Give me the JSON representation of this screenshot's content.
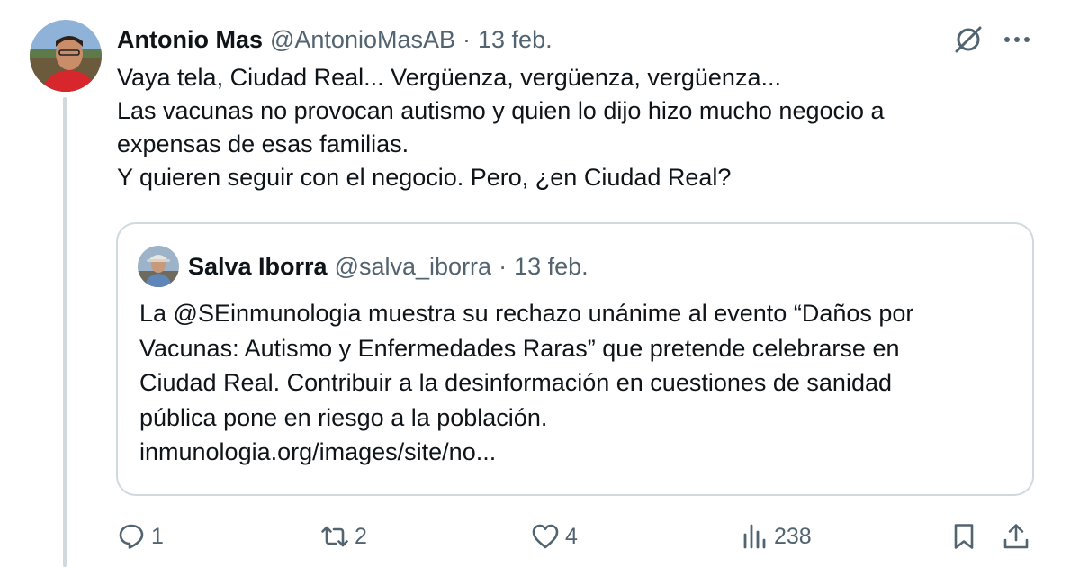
{
  "tweet": {
    "author": {
      "name": "Antonio Mas",
      "handle": "@AntonioMasAB",
      "separator": "·",
      "date": "13 feb."
    },
    "lines": [
      "Vaya tela, Ciudad Real... Vergüenza, vergüenza, vergüenza...",
      "Las vacunas no provocan autismo y quien lo dijo hizo mucho negocio a",
      "expensas de esas familias.",
      "Y quieren seguir con el negocio. Pero, ¿en Ciudad Real?"
    ]
  },
  "quote": {
    "author": {
      "name": "Salva Iborra",
      "handle": "@salva_iborra",
      "separator": "·",
      "date": "13 feb."
    },
    "lines": [
      "La @SEinmunologia  muestra su rechazo unánime al evento “Daños por",
      "Vacunas: Autismo y Enfermedades Raras” que pretende celebrarse en",
      "Ciudad Real. Contribuir a la desinformación en cuestiones de sanidad",
      "pública pone en riesgo a la población.",
      "inmunologia.org/images/site/no..."
    ]
  },
  "actions": {
    "replies": "1",
    "retweets": "2",
    "likes": "4",
    "views": "238"
  },
  "icons": {
    "grok": "grok-icon",
    "more": "more-icon",
    "reply": "reply-icon",
    "retweet": "retweet-icon",
    "like": "heart-icon",
    "views": "views-icon",
    "bookmark": "bookmark-icon",
    "share": "share-icon"
  },
  "colors": {
    "text": "#0f1419",
    "secondary": "#536471",
    "border": "#cfd9de"
  }
}
